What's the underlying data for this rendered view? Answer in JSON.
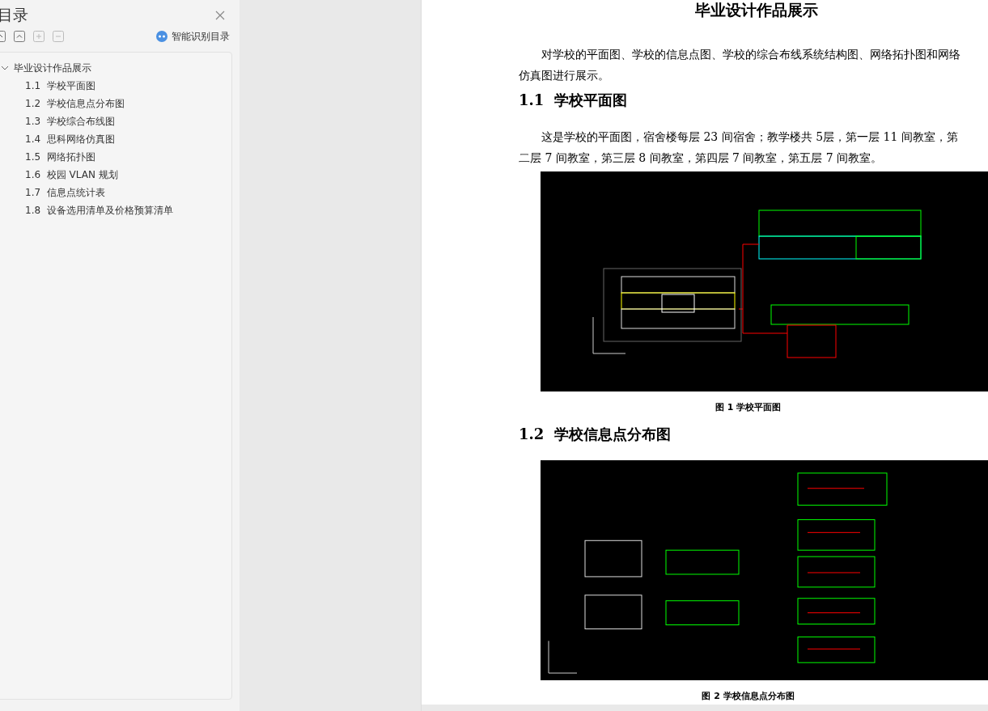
{
  "sidebar": {
    "title": "目录",
    "smart_button": "智能识别目录",
    "toc": [
      {
        "label": "毕业设计作品展示",
        "expanded": true,
        "children": [
          {
            "number": "1.1",
            "label": "学校平面图"
          },
          {
            "number": "1.2",
            "label": "学校信息点分布图"
          },
          {
            "number": "1.3",
            "label": "学校综合布线图"
          },
          {
            "number": "1.4",
            "label": "思科网络仿真图"
          },
          {
            "number": "1.5",
            "label": "网络拓扑图"
          },
          {
            "number": "1.6",
            "label": "校园 VLAN 规划"
          },
          {
            "number": "1.7",
            "label": "信息点统计表"
          },
          {
            "number": "1.8",
            "label": "设备选用清单及价格预算清单"
          }
        ]
      }
    ]
  },
  "document": {
    "title": "毕业设计作品展示",
    "blocks": [
      {
        "kind": "paragraph",
        "text": "对学校的平面图、学校的信息点图、学校的综合布线系统结构图、网络拓扑图和网络仿真图进行展示。"
      },
      {
        "kind": "heading",
        "number": "1.1",
        "text": "学校平面图"
      },
      {
        "kind": "paragraph",
        "text": "这是学校的平面图，宿舍楼每层 23 间宿舍；教学楼共 5层，第一层 11 间教室，第二层 7 间教室，第三层 8 间教室，第四层 7 间教室，第五层 7 间教室。"
      },
      {
        "kind": "planfigure",
        "caption": "图 1  学校平面图"
      },
      {
        "kind": "heading",
        "number": "1.2",
        "text": "学校信息点分布图"
      },
      {
        "kind": "pointsfigure",
        "caption": "图 2 学校信息点分布图"
      }
    ]
  }
}
